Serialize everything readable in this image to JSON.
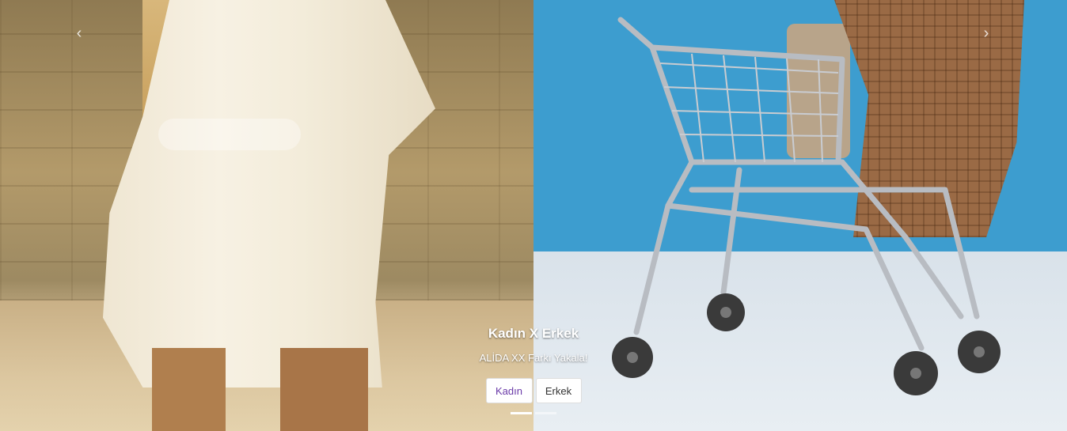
{
  "carousel": {
    "prev_icon": "chevron-left-icon",
    "next_icon": "chevron-right-icon",
    "prev_glyph": "‹",
    "next_glyph": "›",
    "caption": {
      "title": "Kadın X Erkek",
      "subtitle": "ALİDA XX Farkı Yakala!"
    },
    "buttons": {
      "women_label": "Kadın",
      "men_label": "Erkek"
    },
    "indicators": {
      "count": 2,
      "active_index": 0
    },
    "colors": {
      "accent_text": "#6a3aa8",
      "right_background": "#3d9dcf"
    }
  }
}
